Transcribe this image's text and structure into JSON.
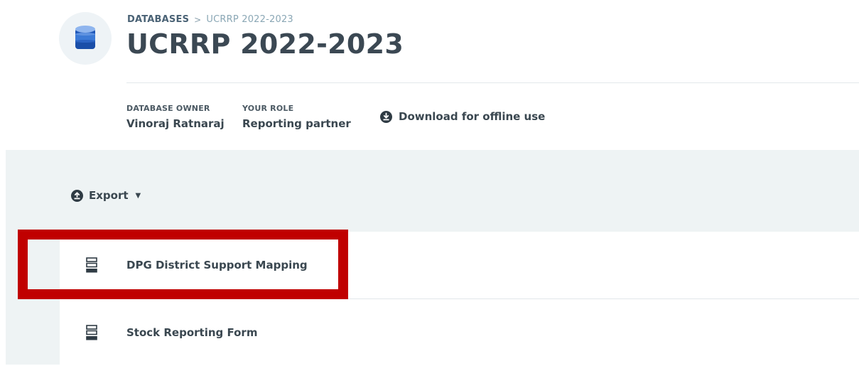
{
  "header": {
    "breadcrumb_root": "DATABASES",
    "breadcrumb_separator": ">",
    "breadcrumb_current": "UCRRP 2022-2023",
    "title": "UCRRP 2022-2023",
    "icon": "database-icon"
  },
  "meta": {
    "owner_label": "DATABASE OWNER",
    "owner_value": "Vinoraj Ratnaraj",
    "role_label": "YOUR ROLE",
    "role_value": "Reporting partner",
    "download_label": "Download for offline use",
    "download_icon": "download-icon"
  },
  "toolbar": {
    "export_label": "Export",
    "export_icon": "upload-icon",
    "caret": "▼"
  },
  "forms": [
    {
      "label": "DPG District Support Mapping",
      "icon": "form-icon"
    },
    {
      "label": "Stock Reporting Form",
      "icon": "form-icon"
    }
  ],
  "colors": {
    "highlight": "#c00000",
    "panel_background": "#eef3f4",
    "database_icon_blue": "#2f6fc7"
  }
}
